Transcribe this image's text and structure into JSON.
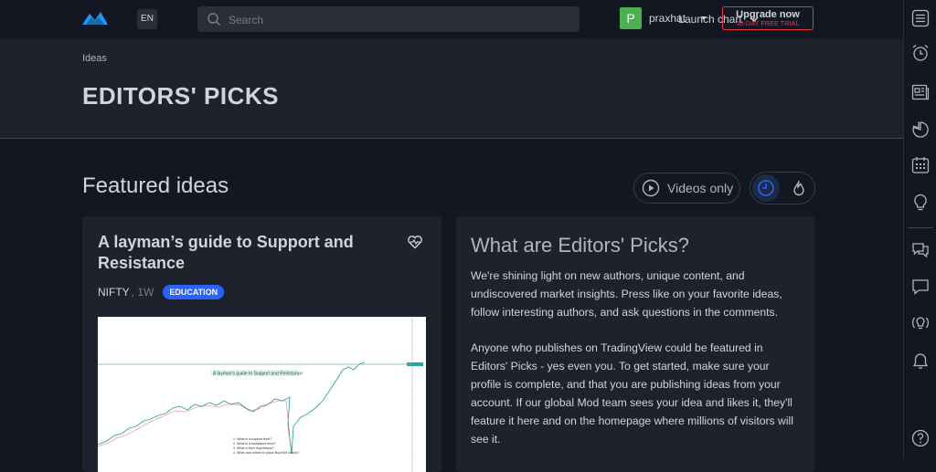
{
  "topbar": {
    "lang": "EN",
    "search_placeholder": "Search",
    "launch_label": "Launch chart",
    "avatar_letter": "P",
    "username": "praxhat",
    "upgrade_title": "Upgrade now",
    "upgrade_sub": "30-DAY FREE TRIAL"
  },
  "header": {
    "breadcrumb": "Ideas",
    "title": "EDITORS' PICKS"
  },
  "featured": {
    "title": "Featured ideas",
    "videos_label": "Videos only"
  },
  "idea": {
    "title": "A layman’s guide to Support and Resistance",
    "symbol": "NIFTY",
    "interval": ", 1W",
    "badge": "EDUCATION",
    "chart_annotation": "A layman's guide to Support and Resistance",
    "chart_list": [
      "1. What is a support level?",
      "2. What is a resistance level?",
      "3. What is their importance?",
      "4. When and where to place Buy/Sell orders?"
    ]
  },
  "info": {
    "title": "What are Editors' Picks?",
    "p1": "We're shining light on new authors, unique content, and undiscovered market insights. Press like on your favorite ideas, follow interesting authors, and ask questions in the comments.",
    "p2": "Anyone who publishes on TradingView could be featured in Editors' Picks - yes even you. To get started, make sure your profile is complete, and that you are publishing ideas from your account. If our global Mod team sees your idea and likes it, they'll feature it here and on the homepage where millions of visitors will see it."
  },
  "colors": {
    "background": "#131722",
    "panel": "#1e222d",
    "accent": "#2962ff",
    "upgrade_border": "#f23645",
    "avatar": "#4caf50"
  },
  "right_toolbar": [
    "menu-icon",
    "alarm-clock-icon",
    "news-icon",
    "pie-chart-icon",
    "calendar-icon",
    "lightbulb-icon",
    "chat-icon",
    "message-icon",
    "broadcast-idea-icon",
    "bell-icon",
    "help-icon"
  ]
}
